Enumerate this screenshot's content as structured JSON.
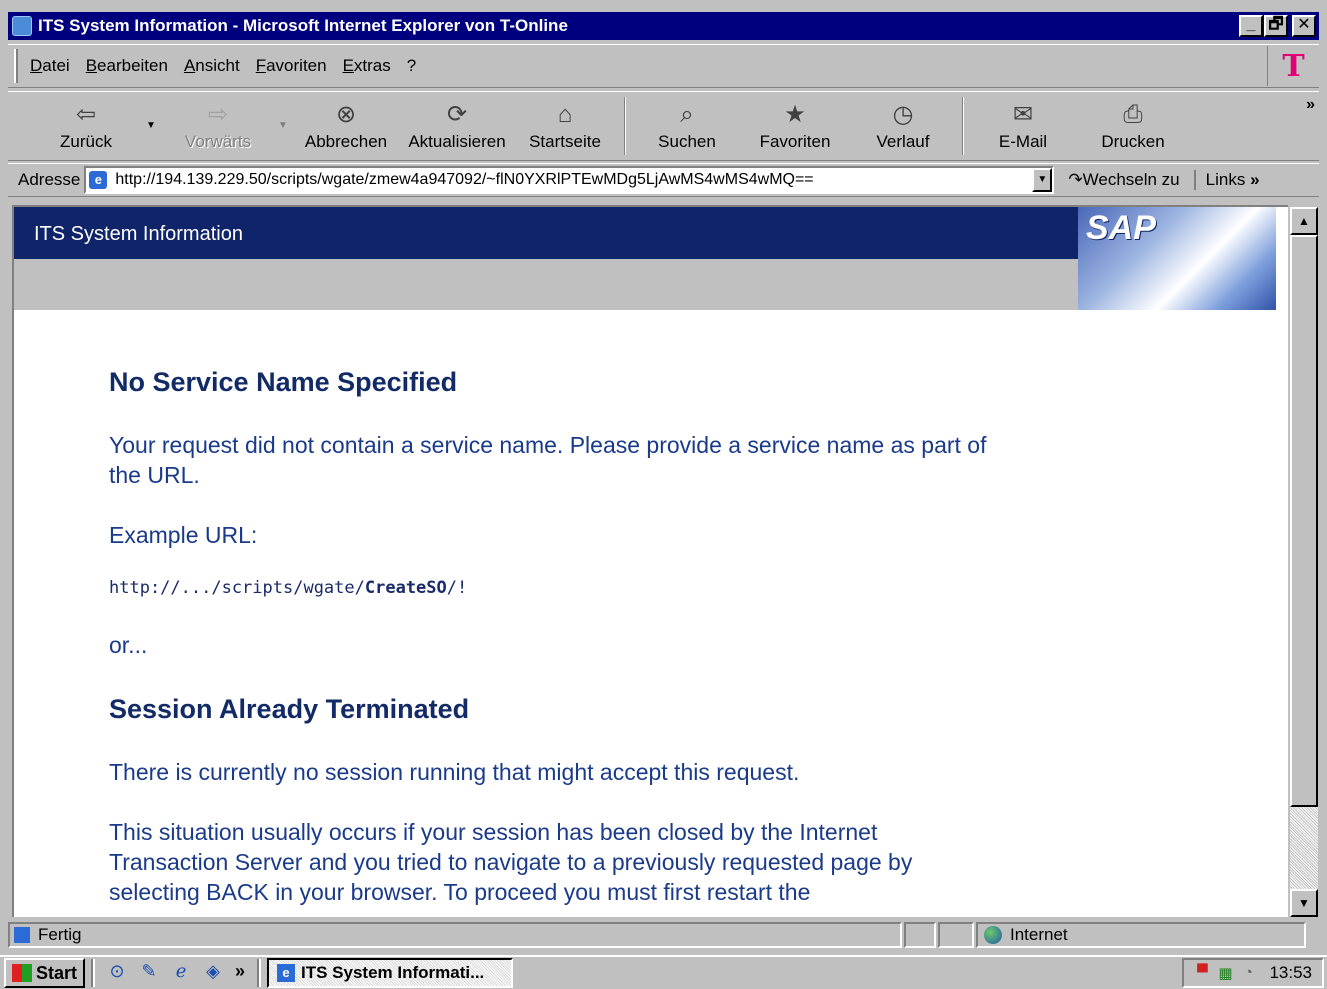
{
  "window": {
    "title": "ITS System Information - Microsoft Internet Explorer von T-Online",
    "buttons": [
      "_",
      "🗗",
      "✕"
    ]
  },
  "menu": [
    "Datei",
    "Bearbeiten",
    "Ansicht",
    "Favoriten",
    "Extras",
    "?"
  ],
  "toolbar": {
    "back": "Zurück",
    "forward": "Vorwärts",
    "stop": "Abbrechen",
    "refresh": "Aktualisieren",
    "home": "Startseite",
    "search": "Suchen",
    "favorites": "Favoriten",
    "history": "Verlauf",
    "mail": "E-Mail",
    "print": "Drucken",
    "overflow": "»"
  },
  "address": {
    "label": "Adresse",
    "url": "http://194.139.229.50/scripts/wgate/zmew4a947092/~flN0YXRlPTEwMDg5LjAwMS4wMS4wMQ==",
    "go": "Wechseln zu",
    "links": "Links",
    "links_chevron": "»"
  },
  "page": {
    "header_title": "ITS System Information",
    "logo_text": "SAP",
    "heading1": "No Service Name Specified",
    "para1": "Your request did not contain a service name. Please provide a service name as part of the URL.",
    "example_label": "Example URL:",
    "code_prefix": "http://.../scripts/wgate/",
    "code_bold": "CreateSO",
    "code_suffix": "/!",
    "or": "or...",
    "heading2": "Session Already Terminated",
    "para2": "There is currently no session running that might accept this request.",
    "para3": "This situation usually occurs if your session has been closed by the Internet Transaction Server and you tried to navigate to a previously requested page by selecting BACK in your browser. To proceed you must first restart the"
  },
  "status": {
    "text": "Fertig",
    "zone": "Internet"
  },
  "taskbar": {
    "start": "Start",
    "task": "ITS System Informati...",
    "clock": "13:53",
    "quicklaunch_chevron": "»"
  }
}
